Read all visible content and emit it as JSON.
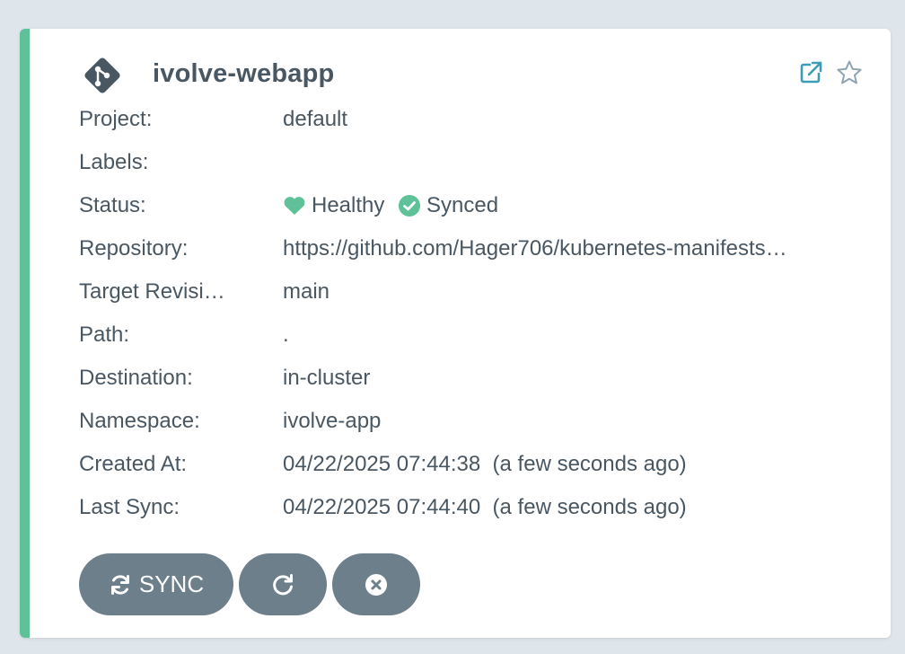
{
  "app": {
    "name": "ivolve-webapp",
    "icon": "git-branch-icon",
    "accent_color": "#5ec198"
  },
  "header_actions": {
    "external_link_icon": "external-link-icon",
    "favorite_icon": "star-icon"
  },
  "fields": {
    "project": {
      "label": "Project:",
      "value": "default"
    },
    "labels": {
      "label": "Labels:",
      "value": ""
    },
    "status": {
      "label": "Status:",
      "health": "Healthy",
      "sync": "Synced",
      "health_color": "#5ec198",
      "sync_color": "#5ec198"
    },
    "repository": {
      "label": "Repository:",
      "value": "https://github.com/Hager706/kubernetes-manifests…"
    },
    "target_revision": {
      "label": "Target Revisi…",
      "value": "main"
    },
    "path": {
      "label": "Path:",
      "value": "."
    },
    "destination": {
      "label": "Destination:",
      "value": "in-cluster"
    },
    "namespace": {
      "label": "Namespace:",
      "value": "ivolve-app"
    },
    "created_at": {
      "label": "Created At:",
      "value": "04/22/2025 07:44:38  (a few seconds ago)"
    },
    "last_sync": {
      "label": "Last Sync:",
      "value": "04/22/2025 07:44:40  (a few seconds ago)"
    }
  },
  "buttons": {
    "sync": {
      "label": "SYNC",
      "icon": "sync-icon"
    },
    "refresh": {
      "icon": "refresh-icon"
    },
    "delete": {
      "icon": "close-circle-icon"
    },
    "color": "#6d7f8b"
  }
}
